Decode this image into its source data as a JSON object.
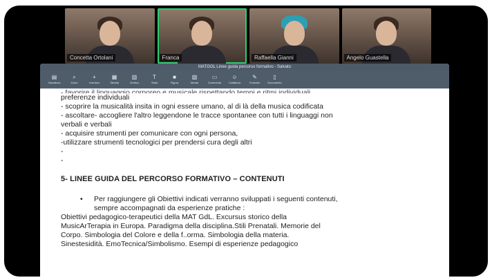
{
  "participants": [
    {
      "name": "Concetta Ortolani",
      "active": false,
      "look": "hair"
    },
    {
      "name": "Franca",
      "active": true,
      "look": "hair"
    },
    {
      "name": "Raffaella Gianni",
      "active": false,
      "look": "cap"
    },
    {
      "name": "Angelo Guastella",
      "active": false,
      "look": "hair"
    }
  ],
  "window": {
    "title": "MATGOL Linee guida percorso formativo - Salvato"
  },
  "toolbar": [
    {
      "icon": "sidebar-icon",
      "glyph": "▤",
      "label": "Visualizza"
    },
    {
      "icon": "zoom-icon",
      "glyph": "⌕",
      "label": "Zoom"
    },
    {
      "icon": "insert-icon",
      "glyph": "+",
      "label": "Inserisci"
    },
    {
      "icon": "table-icon",
      "glyph": "▦",
      "label": "Tabella"
    },
    {
      "icon": "chart-icon",
      "glyph": "▥",
      "label": "Grafico"
    },
    {
      "icon": "text-icon",
      "glyph": "T",
      "label": "Testo"
    },
    {
      "icon": "shape-icon",
      "glyph": "■",
      "label": "Figura"
    },
    {
      "icon": "media-icon",
      "glyph": "▨",
      "label": "Media"
    },
    {
      "icon": "comment-icon",
      "glyph": "▭",
      "label": "Commento"
    },
    {
      "icon": "collaborate-icon",
      "glyph": "☺",
      "label": "Collabora"
    },
    {
      "icon": "format-icon",
      "glyph": "✎",
      "label": "Formato"
    },
    {
      "icon": "document-icon",
      "glyph": "▯",
      "label": "Documento"
    }
  ],
  "document": {
    "cut_line": "- favorire il linguaggio corporeo e musicale rispettando tempi e ritmi individuali",
    "lines_top": [
      "preferenze individuali",
      "- scoprire la musicalità insita in ogni essere umano, al di là della musica codificata",
      "- ascoltare- accogliere l'altro leggendone le tracce spontanee con tutti i linguaggi non",
      "verbali e verbali",
      "- acquisire  strumenti per comunicare con ogni  persona,",
      "-utilizzare strumenti tecnologici  per prendersi cura degli altri",
      "-",
      "-"
    ],
    "heading": "5- LINEE GUIDA DEL PERCORSO FORMATIVO – CONTENUTI",
    "bullet_symbol": "•",
    "bullet_lines": [
      "Per raggiungere gli Obiettivi indicati verranno sviluppati i seguenti contenuti,",
      "sempre accompagnati da esperienze pratiche  :"
    ],
    "lines_bottom": [
      "Obiettivi pedagogico-terapeutici della MAT GdL. Excursus storico della",
      "MusicArTerapia in Europa. Paradigma della disciplina.Stili Prenatali. Memorie del",
      "Corpo. Simbologia del Colore e  della f..orma. Simbologia della materia.",
      "Sinestesidità. EmoTecnica/Simbolismo. Esempi di esperienze pedagogico"
    ]
  }
}
